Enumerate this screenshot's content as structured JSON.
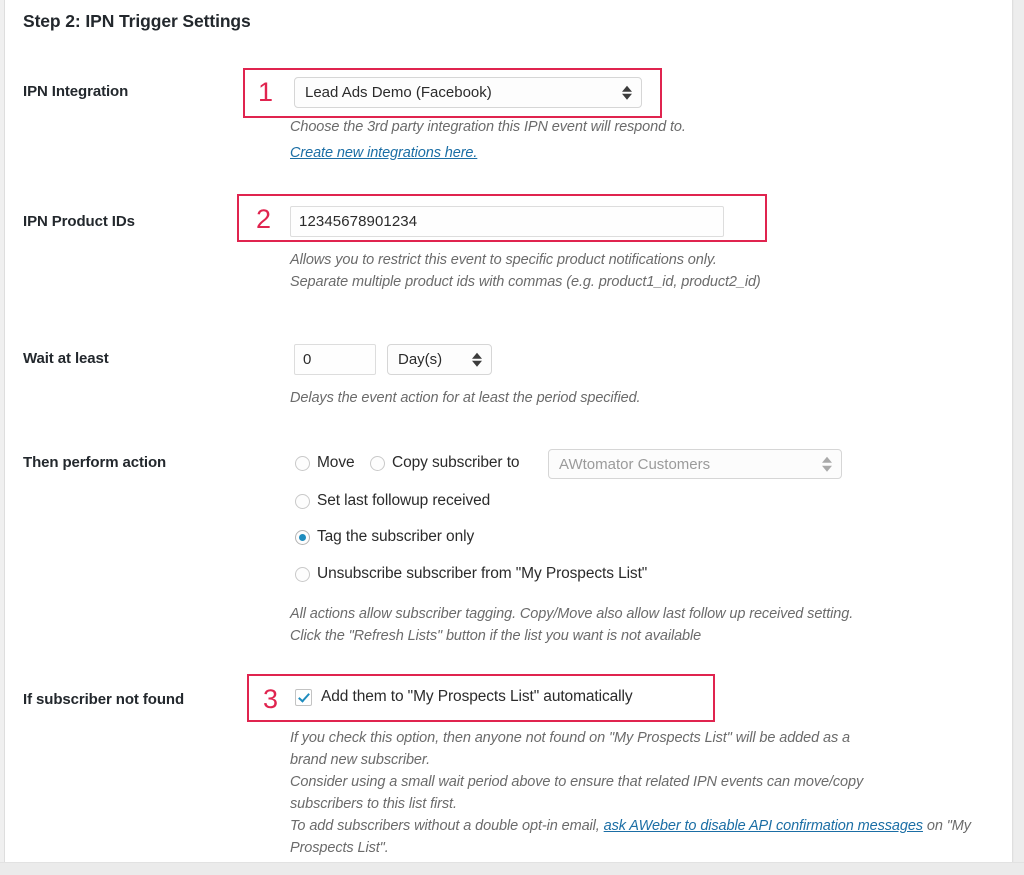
{
  "page": {
    "title": "Step 2: IPN Trigger Settings",
    "accent_red": "#e0244f",
    "link_blue": "#1b6ea5",
    "control_blue": "#1e8cbe"
  },
  "rows": {
    "ipn_integration": {
      "label": "IPN Integration",
      "select_value": "Lead Ads Demo (Facebook)",
      "helper": "Choose the 3rd party integration this IPN event will respond to.",
      "link": "Create new integrations here."
    },
    "ipn_product_ids": {
      "label": "IPN Product IDs",
      "input_value": "12345678901234",
      "helper_line1": "Allows you to restrict this event to specific product notifications only.",
      "helper_line2": "Separate multiple product ids with commas (e.g. product1_id, product2_id)"
    },
    "wait_at_least": {
      "label": "Wait at least",
      "amount_value": "0",
      "unit_value": "Day(s)",
      "helper": "Delays the event action for at least the period specified."
    },
    "then_perform_action": {
      "label": "Then perform action",
      "option_move": "Move",
      "option_copy": "Copy subscriber to",
      "list_select_value": "AWtomator Customers",
      "option_set_last_followup": "Set last followup received",
      "option_tag_only": "Tag the subscriber only",
      "option_unsubscribe": "Unsubscribe subscriber from  \"My Prospects List\"",
      "selected": "tag_only",
      "helper_line1": "All actions allow subscriber tagging. Copy/Move also allow last follow up received setting.",
      "helper_line2": "Click the \"Refresh Lists\" button if the list you want is not available"
    },
    "if_subscriber_not_found": {
      "label": "If subscriber not found",
      "checkbox_label": "Add them to \"My Prospects List\" automatically",
      "checked": true,
      "helper_line1": "If you check this option, then anyone not found on \"My Prospects List\" will be added as a",
      "helper_line2": "brand new subscriber.",
      "helper_line3": "Consider using a small wait period above to ensure that related IPN events can move/copy",
      "helper_line4": "subscribers to this list first.",
      "helper_line5_pre": "To add subscribers without a double opt-in email, ",
      "helper_link": "ask AWeber to disable API confirmation messages",
      "helper_line5_post": " on \"My Prospects List\"."
    }
  },
  "annotations": {
    "one": "1",
    "two": "2",
    "three": "3"
  }
}
